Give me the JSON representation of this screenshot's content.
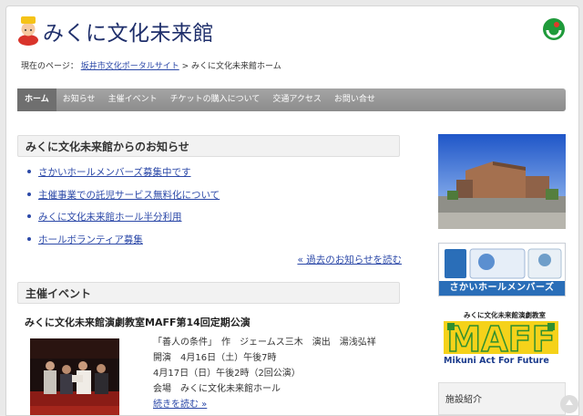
{
  "header": {
    "site_title": "みくに文化未来館",
    "logo_icon": "mikuni-mascot-icon",
    "emblem_icon": "sakai-city-emblem-icon"
  },
  "breadcrumb": {
    "prefix": "現在のページ：",
    "portal_link": "坂井市文化ポータルサイト",
    "separator": ">",
    "current": "みくに文化未来館ホーム"
  },
  "nav": {
    "items": [
      "ホーム",
      "お知らせ",
      "主催イベント",
      "チケットの購入について",
      "交通アクセス",
      "お問い合せ"
    ]
  },
  "news": {
    "title": "みくに文化未来館からのお知らせ",
    "items": [
      "さかいホールメンバーズ募集中です",
      "主催事業での託児サービス無料化について",
      "みくに文化未来館ホール半分利用",
      "ホールボランティア募集"
    ],
    "past_link": "« 過去のお知らせを読む"
  },
  "events": {
    "title": "主催イベント",
    "heading": "みくに文化未来館演劇教室MAFF第14回定期公演",
    "details": [
      "「善人の条件」　作　ジェームス三木　演出　湯浅弘祥",
      "開演　4月16日（土）午後7時",
      "4月17日（日）午後2時（2回公演）",
      "会場　みくに文化未来館ホール"
    ],
    "more_link": "続きを読む »"
  },
  "sidebar": {
    "member_banner": "さかいホールメンバーズ",
    "maff_banner_top": "みくに文化未来館演劇教室",
    "maff_banner_logo": "MAFF",
    "maff_banner_sub": "Mikuni Act For Future",
    "facility_title": "施設紹介"
  },
  "colors": {
    "title_navy": "#1f2f6b",
    "link_blue": "#2c49a8",
    "nav_gray": "#999999",
    "member_blue": "#2a6eb8",
    "maff_yellow": "#f5d21a",
    "maff_green": "#2f8f2f",
    "emblem_green": "#1f9a3a"
  }
}
